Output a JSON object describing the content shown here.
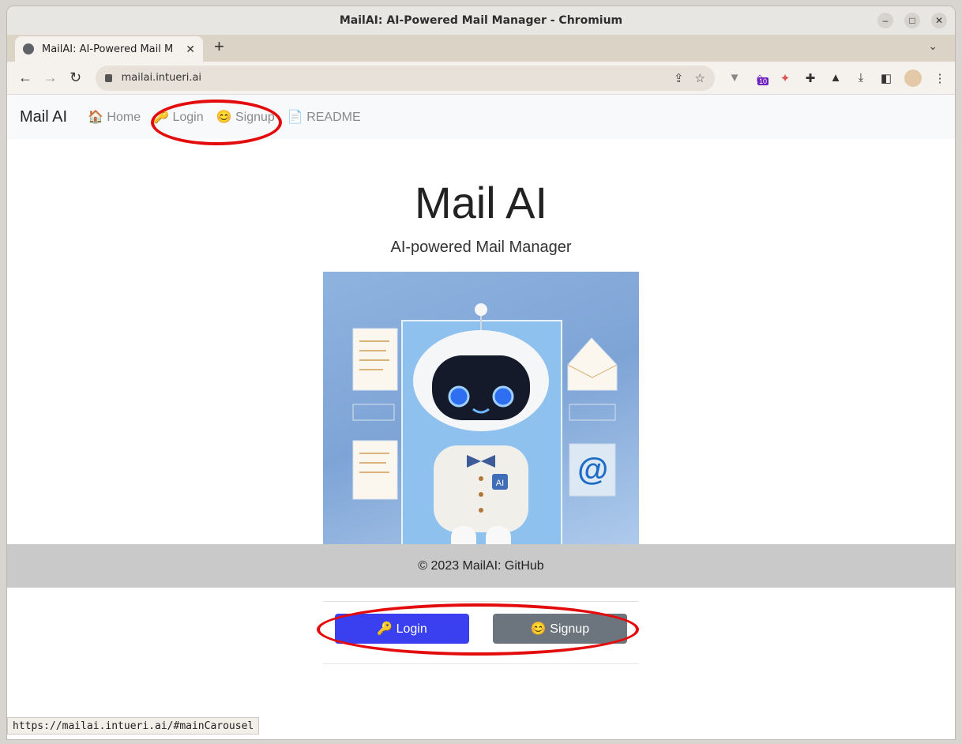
{
  "window": {
    "title": "MailAI: AI-Powered Mail Manager - Chromium"
  },
  "tab": {
    "title": "MailAI: AI-Powered Mail M"
  },
  "address": {
    "url": "mailai.intueri.ai"
  },
  "extensions": {
    "badge_count": "10"
  },
  "navbar": {
    "brand": "Mail AI",
    "links": [
      {
        "icon": "🏠",
        "label": "Home"
      },
      {
        "icon": "🔑",
        "label": "Login"
      },
      {
        "icon": "😊",
        "label": "Signup"
      },
      {
        "icon": "📄",
        "label": "README"
      }
    ]
  },
  "hero": {
    "title": "Mail AI",
    "subtitle": "AI-powered Mail Manager",
    "robot_badge": "AI"
  },
  "buttons": {
    "login": "🔑 Login",
    "signup": "😊 Signup"
  },
  "footer": {
    "text": "© 2023 MailAI: GitHub"
  },
  "status": {
    "url": "https://mailai.intueri.ai/#mainCarousel"
  },
  "colors": {
    "login_button": "#3a3ff0",
    "signup_button": "#6c757d",
    "annotation": "#e30b0b"
  }
}
